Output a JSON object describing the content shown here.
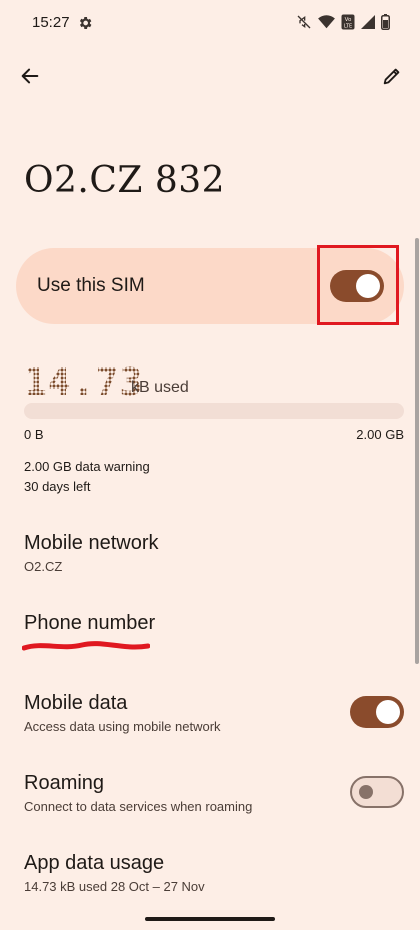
{
  "status_bar": {
    "time": "15:27",
    "icons": [
      "settings-gear-icon",
      "mute-icon",
      "wifi-icon",
      "volte-icon",
      "signal-icon",
      "battery-icon"
    ],
    "volte_label": "Vo\nLTE"
  },
  "app_bar": {
    "back_icon": "arrow-back-icon",
    "edit_icon": "pencil-icon"
  },
  "page": {
    "title": "O2.CZ 832"
  },
  "sim": {
    "label": "Use this SIM",
    "enabled": true
  },
  "usage": {
    "amount": "14.73",
    "unit": "kB used",
    "range_min": "0 B",
    "range_max": "2.00 GB",
    "usage_fraction": 0.0,
    "warning": "2.00 GB data warning",
    "days_left": "30 days left"
  },
  "items": {
    "mobile_network": {
      "title": "Mobile network",
      "sub": "O2.CZ"
    },
    "phone_number": {
      "title": "Phone number"
    },
    "mobile_data": {
      "title": "Mobile data",
      "sub": "Access data using mobile network",
      "enabled": true
    },
    "roaming": {
      "title": "Roaming",
      "sub": "Connect to data services when roaming",
      "enabled": false
    },
    "app_data_usage": {
      "title": "App data usage",
      "sub": "14.73 kB used 28 Oct – 27 Nov"
    }
  },
  "colors": {
    "background": "#fdeee6",
    "card": "#fcd9c8",
    "accent": "#8a4b2c",
    "highlight": "#e01820"
  }
}
